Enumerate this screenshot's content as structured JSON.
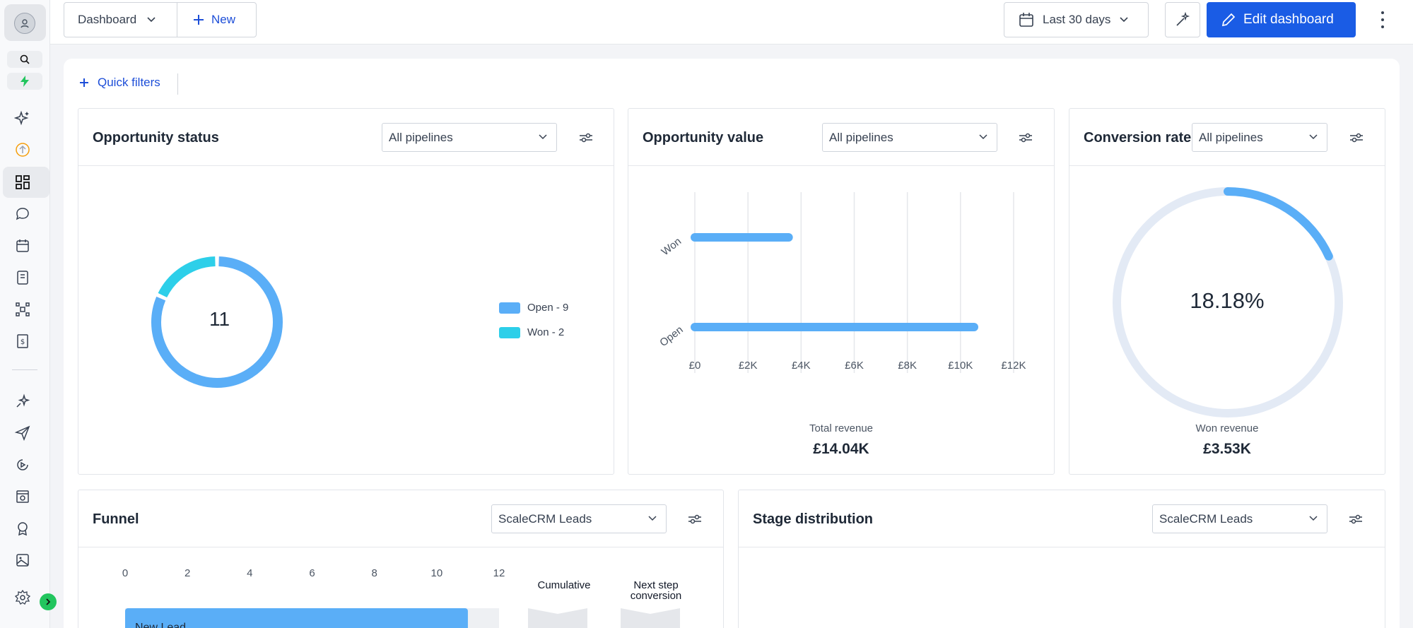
{
  "topbar": {
    "dashboard_label": "Dashboard",
    "new_label": "New",
    "date_range": "Last 30 days",
    "edit_label": "Edit dashboard"
  },
  "quick_filters": "Quick filters",
  "cards": {
    "opportunity_status": {
      "title": "Opportunity status",
      "filter": "All pipelines",
      "total": "11",
      "legend": [
        {
          "label": "Open - 9",
          "color": "#5aaef7"
        },
        {
          "label": "Won - 2",
          "color": "#2dcfe9"
        }
      ]
    },
    "opportunity_value": {
      "title": "Opportunity value",
      "filter": "All pipelines",
      "total_label": "Total revenue",
      "total_value": "£14.04K"
    },
    "conversion_rate": {
      "title": "Conversion rate",
      "filter": "All pipelines",
      "percent": "18.18%",
      "won_label": "Won revenue",
      "won_value": "£3.53K"
    },
    "funnel": {
      "title": "Funnel",
      "filter": "ScaleCRM Leads",
      "col_cumulative": "Cumulative",
      "col_next_line1": "Next step",
      "col_next_line2": "conversion",
      "first_stage": "New Lead"
    },
    "stage_distribution": {
      "title": "Stage distribution",
      "filter": "ScaleCRM Leads"
    }
  },
  "chart_data": [
    {
      "type": "pie",
      "labels": [
        "Open",
        "Won"
      ],
      "values": [
        9,
        2
      ],
      "colors": [
        "#5aaef7",
        "#2dcfe9"
      ]
    },
    {
      "type": "bar",
      "orientation": "horizontal",
      "categories": [
        "Won",
        "Open"
      ],
      "values": [
        3530,
        10510
      ],
      "color": "#5aaef7",
      "xlim": [
        0,
        12000
      ],
      "xticks": [
        "£0",
        "£2K",
        "£4K",
        "£6K",
        "£8K",
        "£10K",
        "£12K"
      ],
      "grid": true
    },
    {
      "type": "pie",
      "labels": [
        "Won",
        "Remaining"
      ],
      "values": [
        18.18,
        81.82
      ],
      "colors": [
        "#5aaef7",
        "#e3eaf5"
      ]
    },
    {
      "type": "bar",
      "orientation": "horizontal",
      "categories": [
        "New Lead"
      ],
      "values": [
        11
      ],
      "color": "#5aaef7",
      "xlim": [
        0,
        12
      ],
      "xticks": [
        "0",
        "2",
        "4",
        "6",
        "8",
        "10",
        "12"
      ]
    }
  ]
}
